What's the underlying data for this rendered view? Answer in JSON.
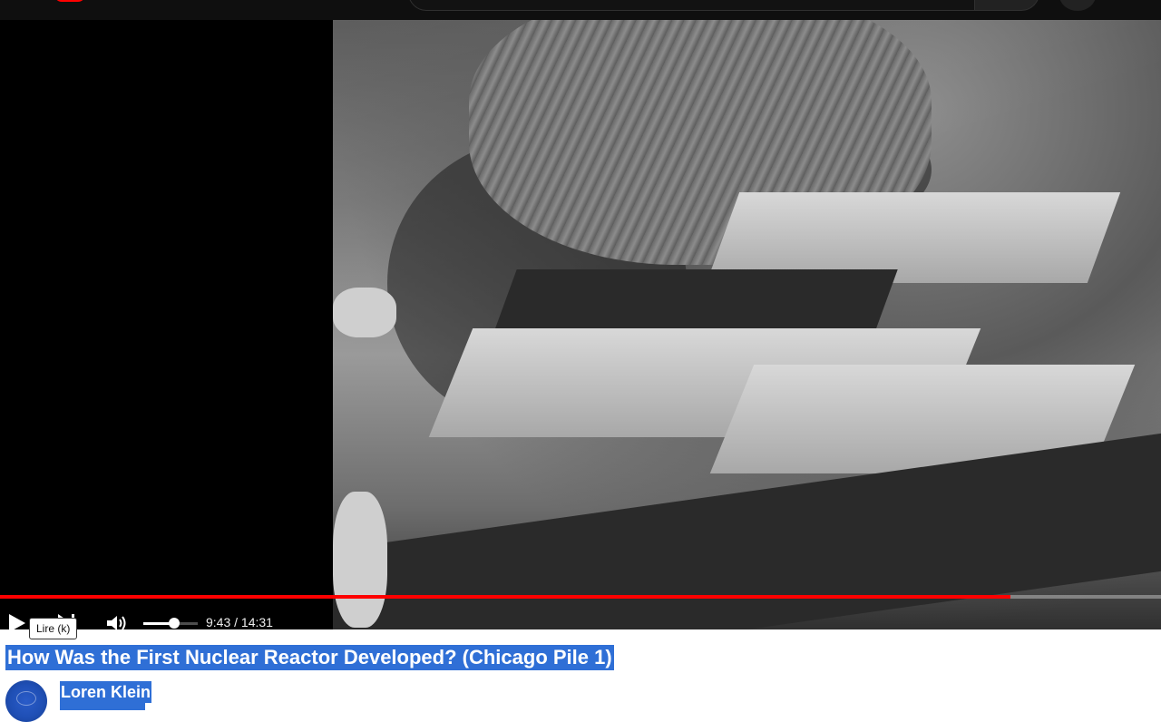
{
  "header": {
    "logo": "youtube-logo",
    "search_placeholder": ""
  },
  "player": {
    "progress_fraction": 0.87,
    "volume_fraction": 0.57,
    "time_current": "9:43",
    "time_total": "14:31",
    "time_display": "9:43 / 14:31",
    "play_tooltip": "Lire (k)",
    "colors": {
      "progress": "#ff0000",
      "background": "#000000"
    },
    "icons": [
      "play-icon",
      "next-icon",
      "volume-icon"
    ]
  },
  "video": {
    "title": "How Was the First Nuclear Reactor Developed? (Chicago Pile 1)"
  },
  "channel": {
    "name": "Loren Klein"
  },
  "colors": {
    "selection": "#2f6fd6"
  }
}
